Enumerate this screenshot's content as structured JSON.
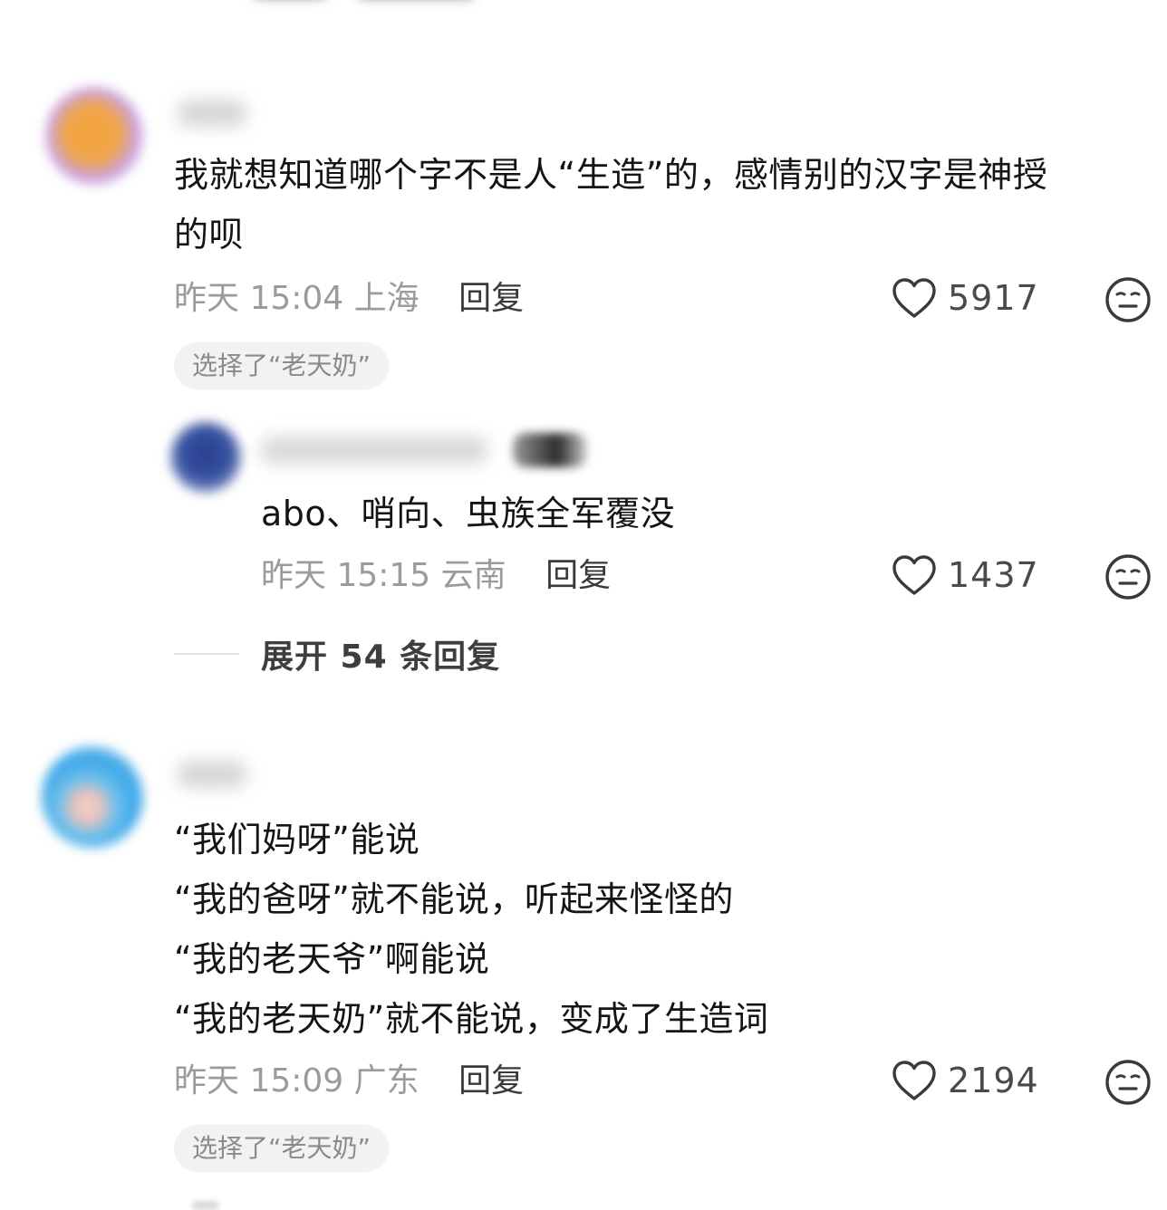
{
  "comments": [
    {
      "text_lines": [
        "我就想知道哪个字不是人“生造”的，感情别的汉字是神授",
        "的呗"
      ],
      "time": "昨天 15:04",
      "location": "上海",
      "reply_label": "回复",
      "likes": "5917",
      "tag": "选择了“老天奶”"
    },
    {
      "text_lines": [
        "abo、哨向、虫族全军覆没"
      ],
      "time": "昨天 15:15",
      "location": "云南",
      "reply_label": "回复",
      "likes": "1437",
      "expand_label": "展开 54 条回复"
    },
    {
      "text_lines": [
        "“我们妈呀”能说",
        "“我的爸呀”就不能说，听起来怪怪的",
        "“我的老天爷”啊能说",
        "“我的老天奶”就不能说，变成了生造词"
      ],
      "time": "昨天 15:09",
      "location": "广东",
      "reply_label": "回复",
      "likes": "2194",
      "tag": "选择了“老天奶”"
    }
  ],
  "icons": {
    "like": "heart-outline-icon",
    "emoji": "neutral-face-icon"
  },
  "colors": {
    "text": "#141414",
    "meta": "#9b9b9b",
    "reply": "#3a3a3a",
    "pill_bg": "#f2f2f2"
  }
}
